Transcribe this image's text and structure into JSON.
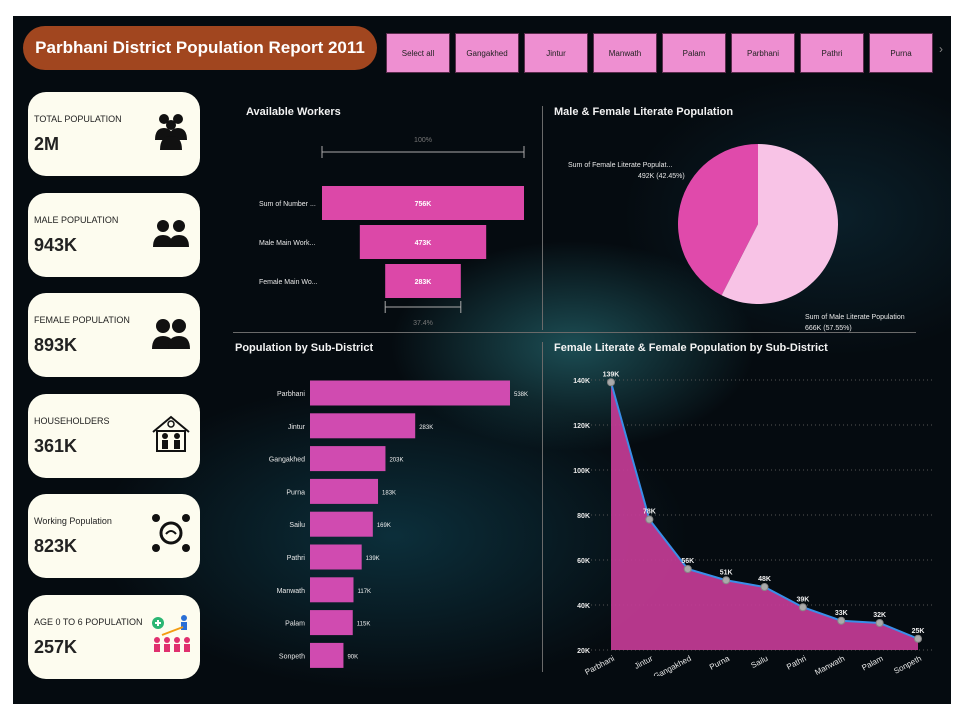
{
  "title": "Parbhani  District Population Report 2011",
  "slicers": [
    "Select all",
    "Gangakhed",
    "Jintur",
    "Manwath",
    "Palam",
    "Parbhani",
    "Pathri",
    "Purna"
  ],
  "kpis": [
    {
      "label": "TOTAL POPULATION",
      "value": "2M",
      "icon": "people-group-icon"
    },
    {
      "label": "MALE POPULATION",
      "value": "943K",
      "icon": "male-users-icon"
    },
    {
      "label": "FEMALE POPULATION",
      "value": "893K",
      "icon": "female-users-icon"
    },
    {
      "label": "HOUSEHOLDERS",
      "value": "361K",
      "icon": "house-family-icon"
    },
    {
      "label": "Working Population",
      "value": "823K",
      "icon": "network-people-icon"
    },
    {
      "label": "AGE 0 TO 6 POPULATION",
      "value": "257K",
      "icon": "children-growth-icon"
    }
  ],
  "chart_data": [
    {
      "type": "bar",
      "chart": "funnel",
      "title": "Available Workers",
      "categories": [
        "Sum of Number ...",
        "Male Main Work...",
        "Female Main Wo..."
      ],
      "values": [
        756000,
        473000,
        283000
      ],
      "labels": [
        "756K",
        "473K",
        "283K"
      ],
      "top_pct": "100%",
      "bottom_pct": "37.4%"
    },
    {
      "type": "pie",
      "title": "Male & Female Literate Population",
      "slices": [
        {
          "name": "Sum of Female Literate Populat...",
          "value": 492000,
          "label": "492K (42.45%)",
          "color": "#e04aab"
        },
        {
          "name": "Sum of Male Literate Population",
          "value": 666000,
          "label": "666K (57.55%)",
          "color": "#f8c3e6"
        }
      ]
    },
    {
      "type": "bar",
      "title": "Population by Sub-District",
      "categories": [
        "Parbhani",
        "Jintur",
        "Gangakhed",
        "Purna",
        "Sailu",
        "Pathri",
        "Manwath",
        "Palam",
        "Sonpeth"
      ],
      "values": [
        538000,
        283000,
        203000,
        183000,
        169000,
        139000,
        117000,
        115000,
        90000
      ],
      "labels": [
        "538K",
        "283K",
        "203K",
        "183K",
        "169K",
        "139K",
        "117K",
        "115K",
        "90K"
      ],
      "color": "#d04bb0"
    },
    {
      "type": "area",
      "title": "Female Literate & Female Population by Sub-District",
      "categories": [
        "Parbhani",
        "Jintur",
        "Gangakhed",
        "Purna",
        "Sailu",
        "Pathri",
        "Manwath",
        "Palam",
        "Sonpeth"
      ],
      "values": [
        139000,
        78000,
        56000,
        51000,
        48000,
        39000,
        33000,
        32000,
        25000
      ],
      "labels": [
        "139K",
        "78K",
        "56K",
        "51K",
        "48K",
        "39K",
        "33K",
        "32K",
        "25K"
      ],
      "ylim": [
        20000,
        140000
      ],
      "yticks": [
        "20K",
        "40K",
        "60K",
        "80K",
        "100K",
        "120K",
        "140K"
      ],
      "fill": "#c43c96",
      "line": "#3a8ee8"
    }
  ]
}
